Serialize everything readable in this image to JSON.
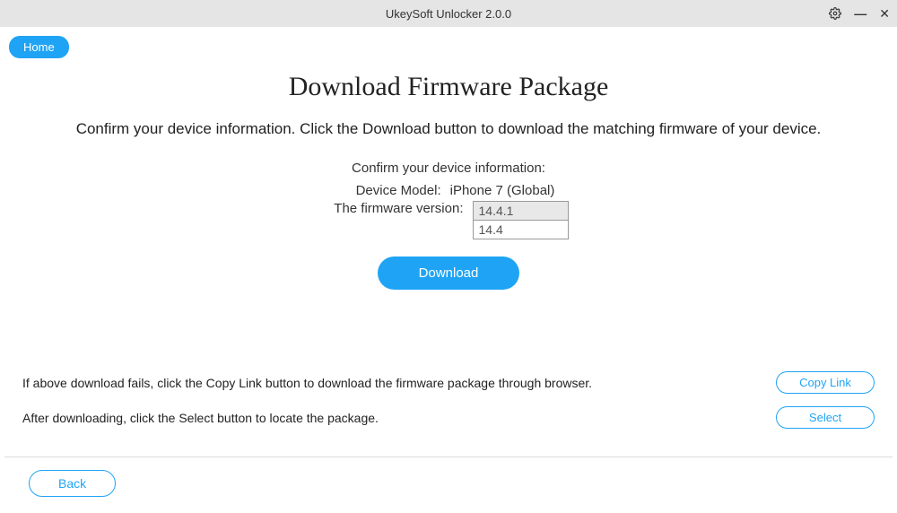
{
  "titlebar": {
    "title": "UkeySoft Unlocker 2.0.0"
  },
  "home_label": "Home",
  "main_heading": "Download Firmware Package",
  "subtitle": "Confirm your device information. Click the Download button to download the matching firmware of your device.",
  "form": {
    "confirm_message": "Confirm your device information:",
    "device_model_label": "Device Model:",
    "device_model_value": "iPhone 7 (Global)",
    "firmware_version_label": "The firmware version:",
    "firmware_selected": "14.4.1",
    "firmware_options": [
      "14.4"
    ]
  },
  "download_label": "Download",
  "bottom": {
    "copy_text": "If above download fails, click the Copy Link button to download the firmware package through browser.",
    "copy_button": "Copy Link",
    "select_text": "After downloading, click the Select button to locate the package.",
    "select_button": "Select"
  },
  "back_label": "Back"
}
